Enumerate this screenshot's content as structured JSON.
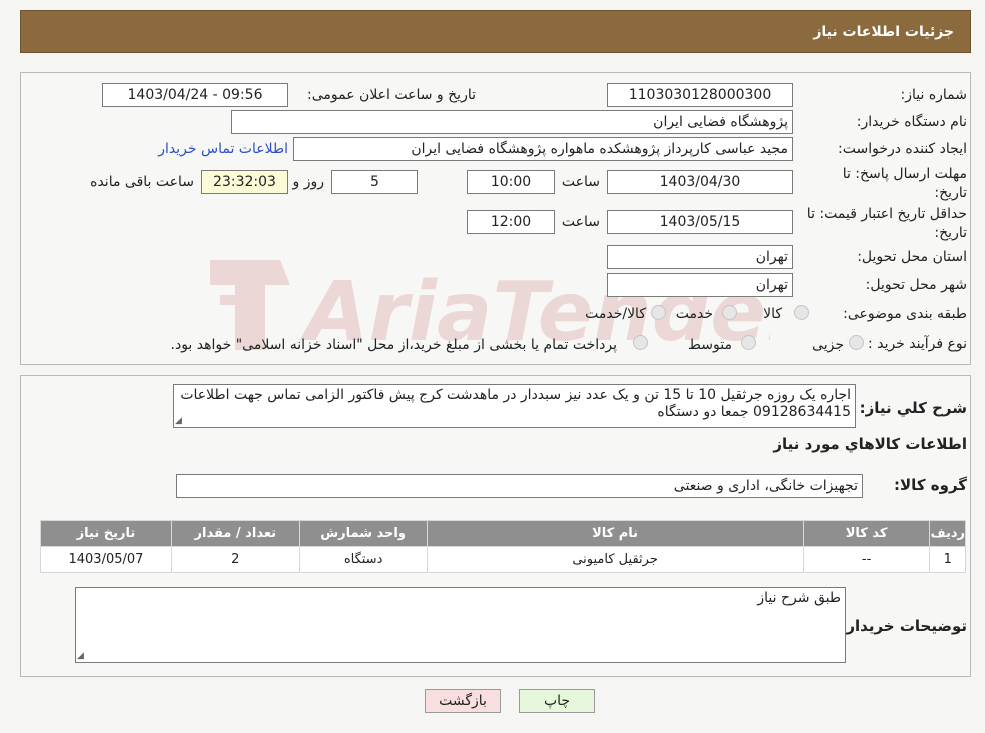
{
  "header": {
    "title": "جزئیات اطلاعات نیاز"
  },
  "need": {
    "number_label": "شماره نیاز:",
    "number": "1103030128000300",
    "announce_label": "تاریخ و ساعت اعلان عمومی:",
    "announce": "1403/04/24 - 09:56",
    "buyer_org_label": "نام دستگاه خریدار:",
    "buyer_org": "پژوهشگاه فضایی ایران",
    "creator_label": "ایجاد کننده درخواست:",
    "creator": "مجید عباسی کارپرداز پژوهشکده ماهواره پژوهشگاه فضایی ایران",
    "contact_link": "اطلاعات تماس خریدار",
    "deadline_label_1": "مهلت ارسال پاسخ: تا",
    "deadline_label_2": "تاریخ:",
    "deadline_date": "1403/04/30",
    "time_label": "ساعت",
    "deadline_time": "10:00",
    "days_value": "5",
    "days_label": "روز و",
    "remaining_time": "23:32:03",
    "remaining_label": "ساعت باقی مانده",
    "validity_label_1": "حداقل تاریخ اعتبار قیمت: تا",
    "validity_label_2": "تاریخ:",
    "validity_date": "1403/05/15",
    "validity_time": "12:00",
    "province_label": "استان محل تحویل:",
    "province": "تهران",
    "city_label": "شهر محل تحویل:",
    "city": "تهران",
    "category_label": "طبقه بندی موضوعی:",
    "category_options": [
      "کالا",
      "خدمت",
      "کالا/خدمت"
    ],
    "process_label": "نوع فرآیند خرید :",
    "process_options": [
      "جزیی",
      "متوسط"
    ],
    "process_note": "پرداخت تمام یا بخشی از مبلغ خرید،از محل \"اسناد خزانه اسلامی\" خواهد بود."
  },
  "details": {
    "desc_label": "شرح کلي نياز:",
    "desc_text": "اجاره یک روزه جرثقیل 10 تا 15 تن و یک عدد  نیز سبددار در ماهدشت کرج پیش فاکتور الزامی تماس جهت اطلاعات 09128634415 جمعا دو دستگاه",
    "goods_title": "اطلاعات کالاهاي مورد نياز",
    "group_label": "گروه کالا:",
    "group_value": "تجهیزات خانگی، اداری و صنعتی",
    "table": {
      "headers": [
        "ردیف",
        "کد کالا",
        "نام کالا",
        "واحد شمارش",
        "تعداد / مقدار",
        "تاریخ نیاز"
      ],
      "rows": [
        [
          "1",
          "--",
          "جرثقیل کامیونی",
          "دستگاه",
          "2",
          "1403/05/07"
        ]
      ]
    },
    "buyer_notes_label": "توضیحات خریدار:",
    "buyer_notes": "طبق شرح نیاز"
  },
  "buttons": {
    "print": "چاپ",
    "back": "بازگشت"
  },
  "watermark": {
    "text": "AriaTender.neT"
  },
  "colors": {
    "header": "#8b6a3e",
    "link": "#2b4fc7",
    "back_button": "#f8dede",
    "print_button": "#e6f7dc"
  }
}
